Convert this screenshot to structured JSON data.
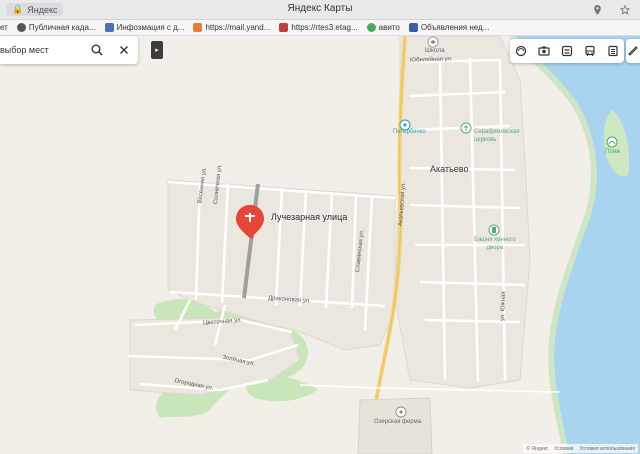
{
  "browser": {
    "tab_label": "Яндекс",
    "title": "Яндекс Карты",
    "bookmarks": [
      {
        "label": "ет",
        "color": "#888888"
      },
      {
        "label": "Публичная када...",
        "color": "#555555"
      },
      {
        "label": "Инфозмация с д...",
        "color": "#4a6fb5"
      },
      {
        "label": "https://mail.yand...",
        "color": "#e0803a"
      },
      {
        "label": "https://rtes3.etag...",
        "color": "#c04040"
      },
      {
        "label": "авито",
        "color": "#4aa85a"
      },
      {
        "label": "Объявления нед...",
        "color": "#3a5ea8"
      }
    ]
  },
  "search": {
    "placeholder": "выбор мест"
  },
  "map": {
    "place_marker_label": "Лучезарная улица",
    "settlement": "Акатьево",
    "pois": {
      "school": "Школа",
      "pharmacy": "Петербичко",
      "church_1": "Серафимовская",
      "church_2": "церковь",
      "tower_1": "Башня конного",
      "tower_2": "двора",
      "beach": "Пляж",
      "farm": "Озерская ферма"
    },
    "streets": {
      "jubilee": "Юбилейная ул.",
      "spring": "Весенняя ул.",
      "sunny": "Солнечная ул.",
      "dragon": "Драконовая ул.",
      "akatievskaya": "Акатьевская ул.",
      "southern": "ул. Южная",
      "glory": "Славянская ул.",
      "cornflower": "Цветочная ул.",
      "evening": "Зелёная ул.",
      "village": "Огородная ул."
    }
  },
  "footer": {
    "yandex": "© Яндекс",
    "terms": "Условия",
    "usage": "Условия использования"
  }
}
